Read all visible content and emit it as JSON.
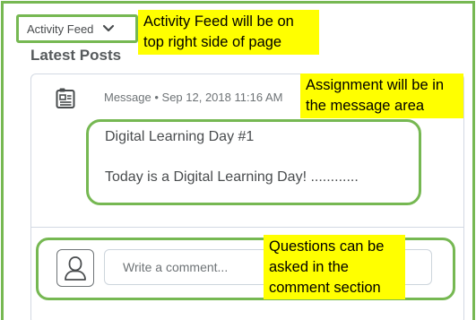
{
  "widget": {
    "title": "Activity Feed",
    "chevron_icon": "chevron-down-icon"
  },
  "section_title": "Latest Posts",
  "post": {
    "type_icon": "message-board-icon",
    "meta": "Message • Sep 12, 2018 11:16 AM",
    "title": "Digital Learning Day #1",
    "body": "Today is a Digital Learning Day!  ............"
  },
  "comment": {
    "avatar_icon": "user-avatar-icon",
    "placeholder": "Write a comment..."
  },
  "annotations": {
    "callout1": "Activity Feed will be on top right side of page",
    "callout2": "Assignment will be in the message area",
    "callout3": "Questions can be asked in the comment section"
  },
  "colors": {
    "highlight_border": "#76b852",
    "callout_bg": "#ffff00"
  }
}
